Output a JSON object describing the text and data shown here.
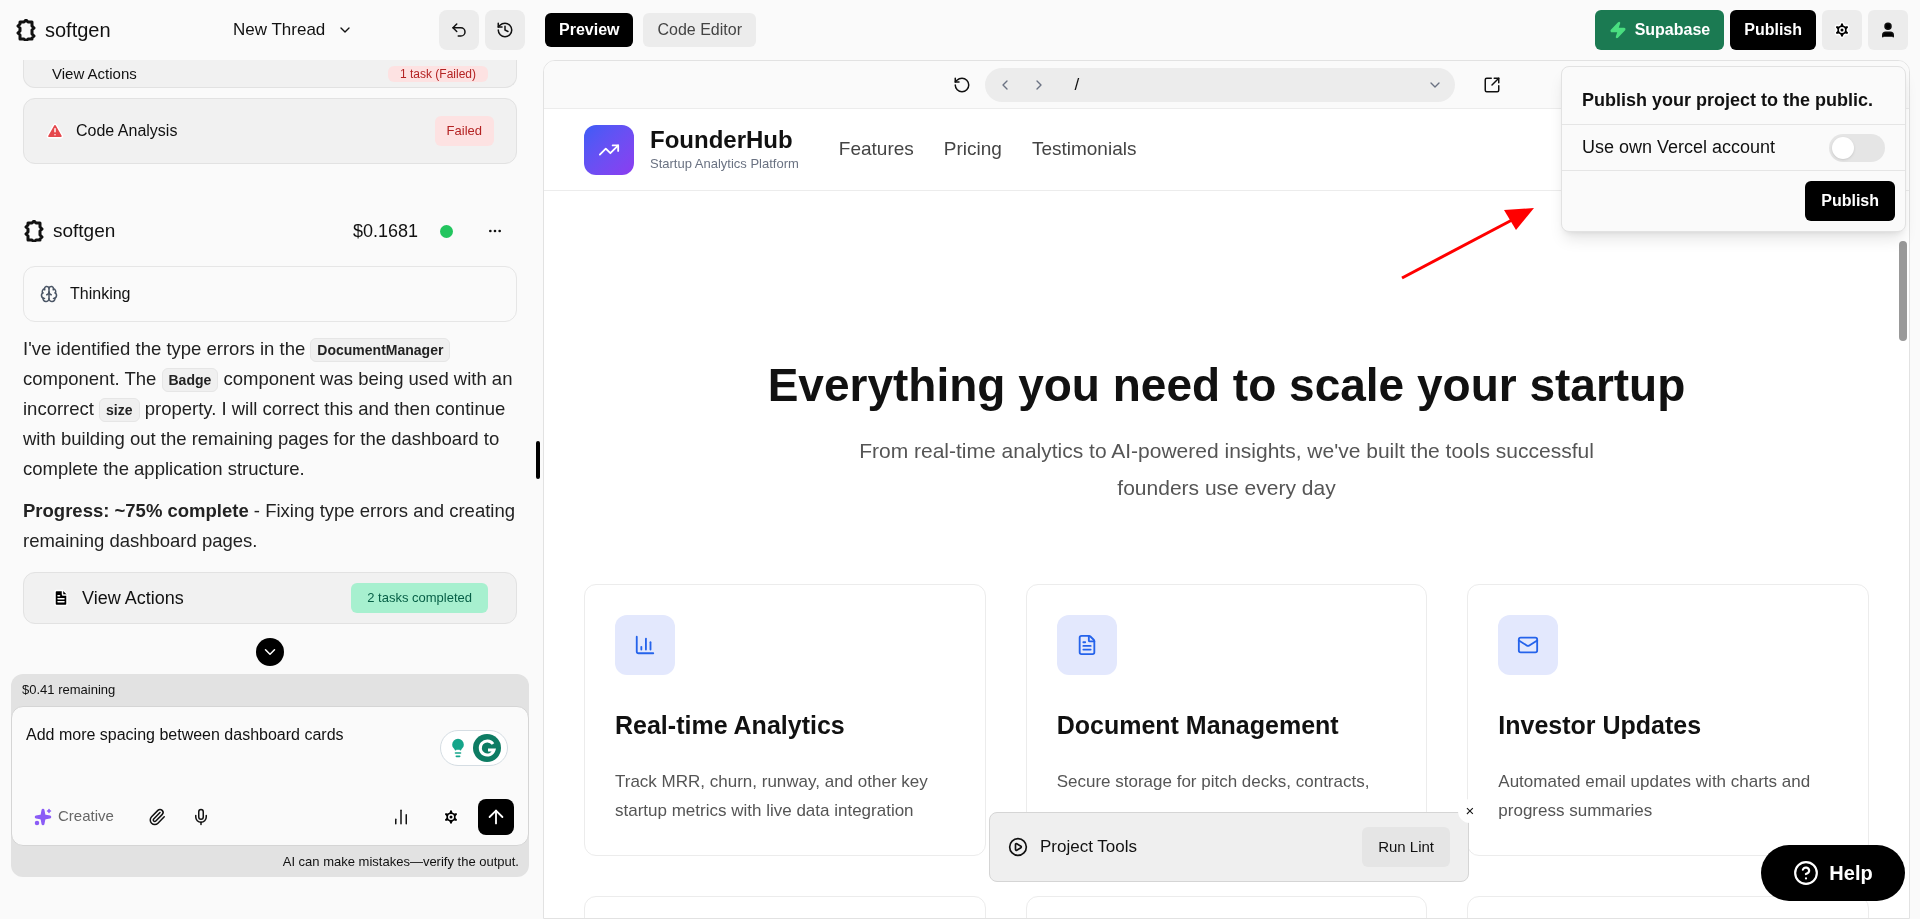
{
  "header": {
    "logo": "softgen",
    "thread_title": "New Thread"
  },
  "chat": {
    "top_actions": {
      "label": "View Actions",
      "badge": "1 task (Failed)",
      "kind": "failed"
    },
    "analysis": {
      "label": "Code Analysis",
      "badge": "Failed",
      "kind": "failed"
    },
    "message": {
      "author": "softgen",
      "cost": "$0.1681",
      "status_dot": {
        "color": "#22c55e"
      },
      "thinking": "Thinking",
      "paragraph": [
        {
          "kind": "text",
          "text": "I've identified the type errors in the "
        },
        {
          "kind": "code",
          "text": "DocumentManager"
        },
        {
          "kind": "text",
          "text": " component. The "
        },
        {
          "kind": "code",
          "text": "Badge"
        },
        {
          "kind": "text",
          "text": " component was being used with an incorrect "
        },
        {
          "kind": "code",
          "text": "size"
        },
        {
          "kind": "text",
          "text": " property. I will correct this and then continue with building out the remaining pages for the dashboard to complete the application structure."
        }
      ],
      "progress": "**Progress: ~75% complete** - Fixing type errors and creating remaining dashboard pages.",
      "actions": {
        "label": "View Actions",
        "badge": "2 tasks completed",
        "kind": "success"
      }
    }
  },
  "composer": {
    "remaining": "$0.41 remaining",
    "value": "Add more spacing between dashboard cards",
    "mode": "Creative",
    "disclaimer": "AI can make mistakes—verify the output."
  },
  "toolbar": {
    "tabs": [
      {
        "label": "Preview",
        "selected": true
      },
      {
        "label": "Code Editor",
        "selected": false
      }
    ],
    "supabase": "Supabase",
    "publish": "Publish"
  },
  "browser": {
    "path": "/"
  },
  "site": {
    "brand": "FounderHub",
    "tagline": "Startup Analytics Platform",
    "nav": [
      "Features",
      "Pricing",
      "Testimonials"
    ],
    "heading": "Everything you need to scale your startup",
    "subheading": "From real-time analytics to AI-powered insights, we've built the tools successful founders use every day",
    "features": [
      {
        "kind": "chart",
        "title": "Real-time Analytics",
        "lines": [
          "Track MRR, churn, runway, and other key",
          "startup metrics with live data integration"
        ]
      },
      {
        "kind": "document",
        "title": "Document Management",
        "lines": [
          "Secure storage for pitch decks, contracts,"
        ]
      },
      {
        "kind": "mail",
        "title": "Investor Updates",
        "lines": [
          "Automated email updates with charts and",
          "progress summaries"
        ]
      }
    ]
  },
  "publish_popover": {
    "title": "Publish your project to the public.",
    "option": "Use own Vercel account",
    "on": false,
    "button": "Publish"
  },
  "project_tools": {
    "label": "Project Tools",
    "button": "Run Lint",
    "close": "×"
  },
  "help": "Help"
}
